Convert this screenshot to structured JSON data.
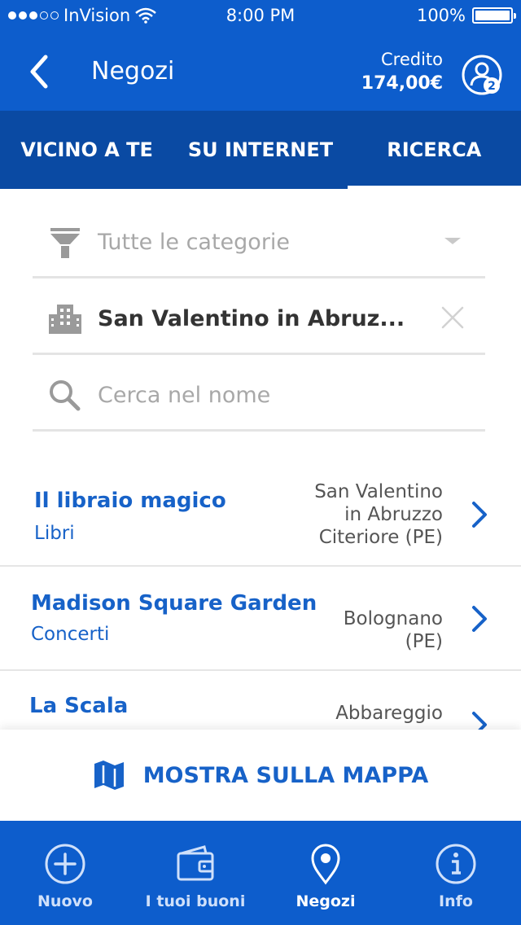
{
  "status_bar": {
    "carrier": "InVision",
    "time": "8:00 PM",
    "battery": "100%",
    "battery_level": 1.0
  },
  "header": {
    "title": "Negozi",
    "credit_label": "Credito",
    "credit_value": "174,00€",
    "profile_badge": "2"
  },
  "tabs": [
    {
      "label": "VICINO A TE",
      "active": false
    },
    {
      "label": "SU INTERNET",
      "active": false
    },
    {
      "label": "RICERCA",
      "active": true
    }
  ],
  "filters": {
    "category_placeholder": "Tutte le categorie",
    "location_value": "San Valentino in Abruz...",
    "search_placeholder": "Cerca nel nome"
  },
  "stores": [
    {
      "name": "Il libraio magico",
      "category": "Libri",
      "location": [
        "San Valentino",
        "in Abruzzo",
        "Citeriore (PE)"
      ]
    },
    {
      "name": "Madison Square Garden",
      "category": "Concerti",
      "location": [
        "Bolognano",
        "(PE)"
      ]
    },
    {
      "name": "La Scala",
      "category": "",
      "location": [
        "Abbareggio"
      ]
    }
  ],
  "map_button": {
    "label": "MOSTRA SULLA MAPPA"
  },
  "bottom_nav": [
    {
      "label": "Nuovo",
      "icon": "plus-circle-icon",
      "active": false
    },
    {
      "label": "I tuoi buoni",
      "icon": "wallet-icon",
      "active": false
    },
    {
      "label": "Negozi",
      "icon": "map-pin-icon",
      "active": true
    },
    {
      "label": "Info",
      "icon": "info-icon",
      "active": false
    }
  ],
  "colors": {
    "primary": "#0d5dcc",
    "tab_bg": "#0a4aa3",
    "link": "#1762c8"
  }
}
